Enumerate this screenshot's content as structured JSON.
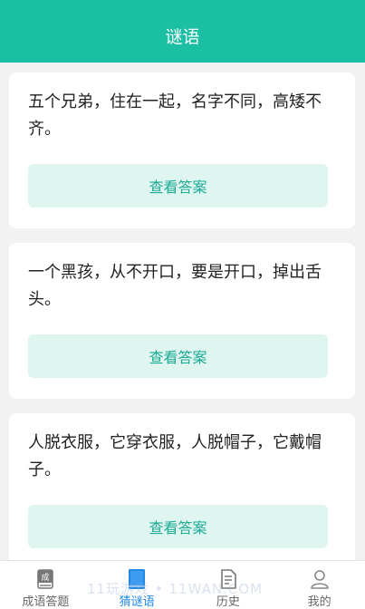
{
  "header": {
    "title": "谜语"
  },
  "riddles": [
    {
      "text": "五个兄弟，住在一起，名字不同，高矮不齐。",
      "button_label": "查看答案"
    },
    {
      "text": "一个黑孩，从不开口，要是开口，掉出舌头。",
      "button_label": "查看答案"
    },
    {
      "text": "人脱衣服，它穿衣服，人脱帽子，它戴帽子。",
      "button_label": "查看答案"
    }
  ],
  "tabbar": {
    "items": [
      {
        "label": "成语答题",
        "icon": "idiom-book-icon",
        "active": false
      },
      {
        "label": "猜谜语",
        "icon": "riddle-book-icon",
        "active": true
      },
      {
        "label": "历史",
        "icon": "history-document-icon",
        "active": false
      },
      {
        "label": "我的",
        "icon": "profile-person-icon",
        "active": false
      }
    ]
  },
  "watermark": {
    "text": "11玩游戏 • 11WAN.COM"
  },
  "colors": {
    "primary": "#1bbfa3",
    "button_bg": "#dff5f0",
    "button_text": "#1bab93",
    "active_tab": "#1e88e5"
  }
}
